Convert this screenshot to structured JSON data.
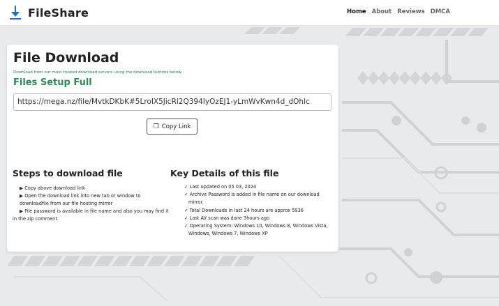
{
  "header": {
    "brand": "FileShare",
    "nav": [
      {
        "label": "Home",
        "active": true
      },
      {
        "label": "About",
        "active": false
      },
      {
        "label": "Reviews",
        "active": false
      },
      {
        "label": "DMCA",
        "active": false
      }
    ]
  },
  "card": {
    "title": "File Download",
    "subtitle": "Download from our most trusted download servers using the download buttons below.",
    "file_name": "Files Setup Full",
    "link": "https://mega.nz/file/MvtkDKbK#5LroIX5JicRl2Q394IyOzEJ1-yLmWvKwn4d_dOhlc",
    "copy_label": "Copy Link",
    "steps_title": "Steps to download file",
    "steps": [
      "Copy above download link",
      "Open the download link into new tab or window to downloadfile from our file hosting mirror",
      "File password is available in file name and also you may find it in the zip comment."
    ],
    "details_title": "Key Details of this file",
    "details": [
      "Last updated on 05 03, 2024",
      "Archive Password is added in file name on our download mirror.",
      "Total Downloads in last 24 hours are approx 5936",
      "Last AV scan was done 3hours ago",
      "Operating System: Windows 10, Windows 8, Windows Vista, Windows, Windows 7, Windows XP"
    ]
  },
  "colors": {
    "accent": "#2e8b57",
    "logo_blue": "#1f6fb5"
  },
  "icons": {
    "logo": "download-arrow-icon",
    "copy": "copy-icon",
    "bullet": "triangle-right-icon",
    "check": "check-icon"
  }
}
